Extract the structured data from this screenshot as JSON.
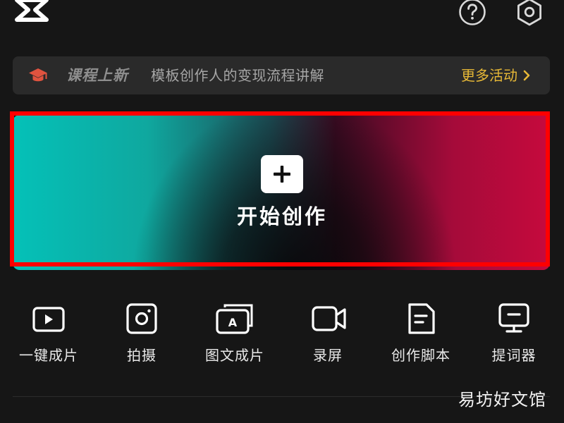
{
  "header": {
    "logo_icon": "capcut-logo-icon",
    "help_icon": "question-circle-icon",
    "settings_icon": "gear-icon"
  },
  "course_banner": {
    "icon": "graduation-cap-icon",
    "tag": "课程上新",
    "description": "模板创作人的变现流程讲解",
    "more_label": "更多活动",
    "more_icon": "chevron-right-icon"
  },
  "create": {
    "label": "开始创作",
    "icon": "plus-icon"
  },
  "tools": [
    {
      "label": "一键成片",
      "icon": "play-box-icon"
    },
    {
      "label": "拍摄",
      "icon": "camera-icon"
    },
    {
      "label": "图文成片",
      "icon": "text-image-icon"
    },
    {
      "label": "录屏",
      "icon": "video-camera-icon"
    },
    {
      "label": "创作脚本",
      "icon": "script-doc-icon"
    },
    {
      "label": "提词器",
      "icon": "teleprompter-icon"
    }
  ],
  "watermark": "易坊好文馆",
  "colors": {
    "background": "#161616",
    "banner_bg": "#2a2a2a",
    "accent_gold": "#e8b937",
    "highlight_red": "#ff0000",
    "gradient_teal": "#04c1b8",
    "gradient_red": "#c60a3d"
  }
}
